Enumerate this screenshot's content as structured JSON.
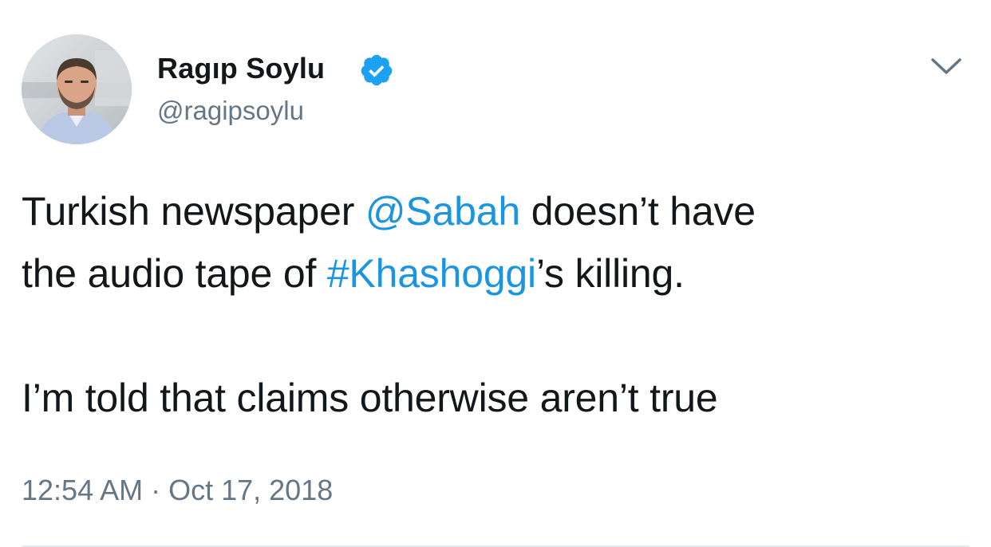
{
  "author": {
    "display_name": "Ragıp Soylu",
    "handle": "@ragipsoylu",
    "verified": true
  },
  "tweet": {
    "line1_pre": "Turkish newspaper ",
    "mention": "@Sabah",
    "line1_post": " doesn’t have",
    "line2_pre": "the audio tape of ",
    "hashtag": "#Khashoggi",
    "line2_post": "’s killing.",
    "line3": "I’m told that claims otherwise aren’t true"
  },
  "meta": {
    "time": "12:54 AM",
    "separator": " · ",
    "date": "Oct 17, 2018"
  },
  "colors": {
    "link": "#1b95e0",
    "verified": "#1da1f2",
    "secondary_text": "#657786",
    "primary_text": "#14171a"
  },
  "icons": {
    "verified": "verified-badge-icon",
    "menu": "chevron-down-icon"
  }
}
